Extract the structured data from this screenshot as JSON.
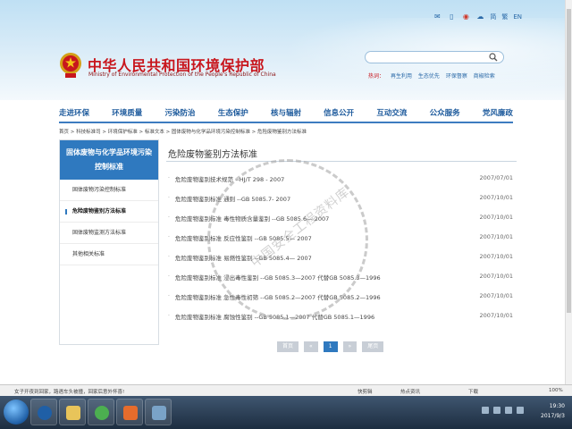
{
  "top_bar": {
    "links": [
      "简",
      "繁",
      "EN"
    ]
  },
  "header": {
    "title_cn": "中华人民共和国环境保护部",
    "title_en": "Ministry of Environmental Protection of the People's Republic of China",
    "hot_label": "热词：",
    "hot_words": [
      "再生利用",
      "生态优先",
      "环保督察",
      "商椒检索"
    ]
  },
  "nav": {
    "items": [
      "走进环保",
      "环境质量",
      "污染防治",
      "生态保护",
      "核与辐射",
      "信息公开",
      "互动交流",
      "公众服务",
      "党风廉政"
    ]
  },
  "breadcrumb": "首页 > 科技标准司 > 环境保护标准 > 标准文本 > 固体废物与化学品环境污染控制标准 > 危险废物鉴别方法标准",
  "sidebar": {
    "heading": "固体废物与化学品环境污染控制标准",
    "items": [
      "固体废物污染控制标准",
      "危险废物鉴别方法标准",
      "固体废物监测方法标准",
      "其他相关标准"
    ]
  },
  "main": {
    "title": "危险废物鉴别方法标准",
    "rows": [
      {
        "title": "危险废物鉴别技术规范 --HJ/T 298 - 2007",
        "date": "2007/07/01"
      },
      {
        "title": "危险废物鉴别标准 通则 --GB 5085.7- 2007",
        "date": "2007/10/01"
      },
      {
        "title": "危险废物鉴别标准 毒性物质含量鉴别 --GB 5085.6— 2007",
        "date": "2007/10/01"
      },
      {
        "title": "危险废物鉴别标准 反应性鉴别 --GB 5085.5— 2007",
        "date": "2007/10/01"
      },
      {
        "title": "危险废物鉴别标准 易燃性鉴别 --GB 5085.4— 2007",
        "date": "2007/10/01"
      },
      {
        "title": "危险废物鉴别标准 浸出毒性鉴别 --GB 5085.3—2007 代替GB 5085.3—1996",
        "date": "2007/10/01"
      },
      {
        "title": "危险废物鉴别标准 急性毒性初筛 --GB 5085.2—2007 代替GB 5085.2—1996",
        "date": "2007/10/01"
      },
      {
        "title": "危险废物鉴别标准 腐蚀性鉴别 --GB 5085.1—2007 代替GB 5085.1—1996",
        "date": "2007/10/01"
      }
    ]
  },
  "pager": {
    "first": "首页",
    "prev": "«",
    "current": "1",
    "next": "»",
    "last": "尾页"
  },
  "watermark": "中国安全工程资料库",
  "status_bar": {
    "message": "女子开夜到回家，路遇车头被撞，回家后意外怀喜!",
    "items": [
      "快剪辑",
      "热点资讯",
      "下载",
      "100%"
    ]
  },
  "taskbar": {
    "time": "19:30",
    "date": "2017/9/3"
  },
  "colors": {
    "brand_red": "#c8161d",
    "nav_blue": "#1d5a9c",
    "accent_blue": "#2f79bf"
  }
}
